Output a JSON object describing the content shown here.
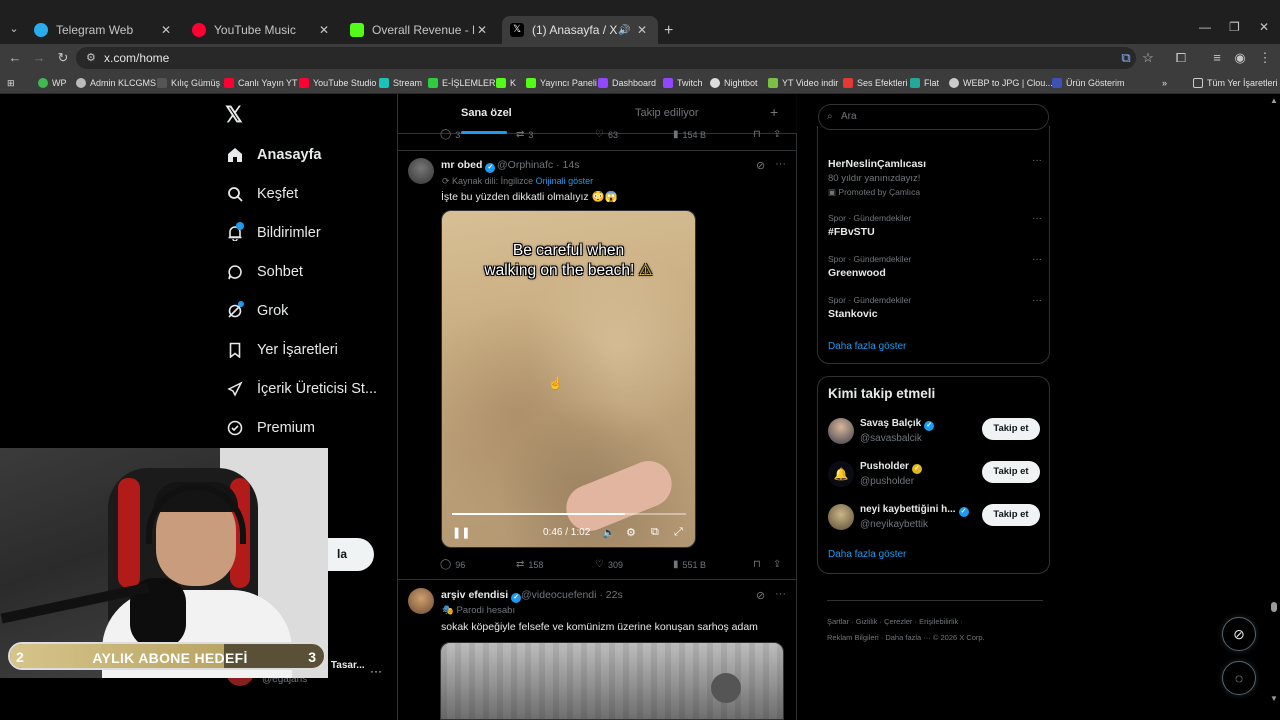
{
  "browser": {
    "tabs": [
      {
        "title": "Telegram Web",
        "color": "#2AABEE"
      },
      {
        "title": "YouTube Music",
        "color": "#FF0033"
      },
      {
        "title": "Overall Revenue - Kick Dashboa",
        "color": "#53FC18"
      },
      {
        "title": "(1) Anasayfa / X",
        "color": "#000000"
      }
    ],
    "url": "x.com/home",
    "bookmarks": [
      {
        "label": "WP",
        "color": "#3FB950"
      },
      {
        "label": "Admin KLCGMS",
        "color": "#BBBBBB"
      },
      {
        "label": "Kılıç Gümüş",
        "color": "#555555"
      },
      {
        "label": "Canlı Yayın YT",
        "color": "#FF0033"
      },
      {
        "label": "YouTube Studio",
        "color": "#FF0033"
      },
      {
        "label": "Stream",
        "color": "#19C3B9"
      },
      {
        "label": "E-İŞLEMLER",
        "color": "#2ECC40"
      },
      {
        "label": "K",
        "color": "#53FC18"
      },
      {
        "label": "Yayıncı Paneli",
        "color": "#53FC18"
      },
      {
        "label": "Dashboard",
        "color": "#9146FF"
      },
      {
        "label": "Twitch",
        "color": "#9146FF"
      },
      {
        "label": "Nightbot",
        "color": "#DDDDDD"
      },
      {
        "label": "YT Video indir",
        "color": "#7BC043"
      },
      {
        "label": "Ses Efektleri",
        "color": "#E53935"
      },
      {
        "label": "Flat",
        "color": "#26A69A"
      },
      {
        "label": "WEBP to JPG | Clou...",
        "color": "#CCCCCC"
      },
      {
        "label": "Ürün Gösterim",
        "color": "#3F51B5"
      }
    ],
    "all_bookmarks": "Tüm Yer İşaretleri"
  },
  "sidebar": {
    "items": [
      {
        "label": "Anasayfa",
        "icon": "home-icon"
      },
      {
        "label": "Keşfet",
        "icon": "search-icon"
      },
      {
        "label": "Bildirimler",
        "icon": "bell-icon"
      },
      {
        "label": "Sohbet",
        "icon": "chat-icon"
      },
      {
        "label": "Grok",
        "icon": "grok-icon"
      },
      {
        "label": "Yer İşaretleri",
        "icon": "bookmark-icon"
      },
      {
        "label": "İçerik Üreticisi St...",
        "icon": "rocket-icon"
      },
      {
        "label": "Premium",
        "icon": "verified-icon"
      }
    ],
    "post_button": "la",
    "account": {
      "name": "Eg Ajans Web Tasar...",
      "handle": "@egajans"
    }
  },
  "overlay": {
    "goal_left": "2",
    "goal_label": "AYLIK ABONE HEDEFİ",
    "goal_right": "3",
    "goal_progress": 0.68
  },
  "feed": {
    "tabs": [
      "Sana özel",
      "Takip ediliyor"
    ],
    "prev_actions": {
      "replies": "3",
      "reposts": "3",
      "likes": "63",
      "views": "154 B"
    },
    "tweet1": {
      "name": "mr obed",
      "handle": "@Orphinafc",
      "time": "· 14s",
      "source_lang": "Kaynak dili: İngilizce",
      "show_original": "Orijinali göster",
      "text": "İşte bu yüzden dikkatli olmalıyız 😳😱",
      "video_caption_1": "Be careful when",
      "video_caption_2": "walking on the beach!",
      "video_time": "0:46 / 1:02",
      "video_progress": 0.74,
      "replies": "96",
      "reposts": "158",
      "likes": "309",
      "views": "551 B"
    },
    "tweet2": {
      "name": "arşiv efendisi",
      "handle": "@videocuefendi",
      "time": "· 22s",
      "badge": "Parodi hesabı",
      "text": "sokak köpeğiyle felsefe ve komünizm üzerine konuşan sarhoş adam"
    }
  },
  "right": {
    "search_placeholder": "Ara",
    "trends": [
      {
        "category": "",
        "title": "HerNeslinÇamlıcası",
        "subtitle": "80 yıldır yanınızdayız!",
        "promo": "Promoted by Çamlıca"
      },
      {
        "category": "Spor · Gündemdekiler",
        "title": "#FBvSTU"
      },
      {
        "category": "Spor · Gündemdekiler",
        "title": "Greenwood"
      },
      {
        "category": "Spor · Gündemdekiler",
        "title": "Stankovic"
      }
    ],
    "show_more": "Daha fazla göster",
    "who_to_follow": {
      "title": "Kimi takip etmeli",
      "users": [
        {
          "name": "Savaş Balçık",
          "handle": "@savasbalcik",
          "verified": "blue"
        },
        {
          "name": "Pusholder",
          "handle": "@pusholder",
          "verified": "gold"
        },
        {
          "name": "neyi kaybettiğini h...",
          "handle": "@neyikaybettik",
          "verified": "blue"
        }
      ],
      "follow_label": "Takip et",
      "show_more": "Daha fazla göster"
    },
    "footer_line1": "Şartlar  ·  Gizlilik  ·  Çerezler  ·  Erişilebilirlik  ·",
    "footer_line2": "Reklam Bilgileri  ·  Daha fazla ···  © 2026 X Corp."
  }
}
